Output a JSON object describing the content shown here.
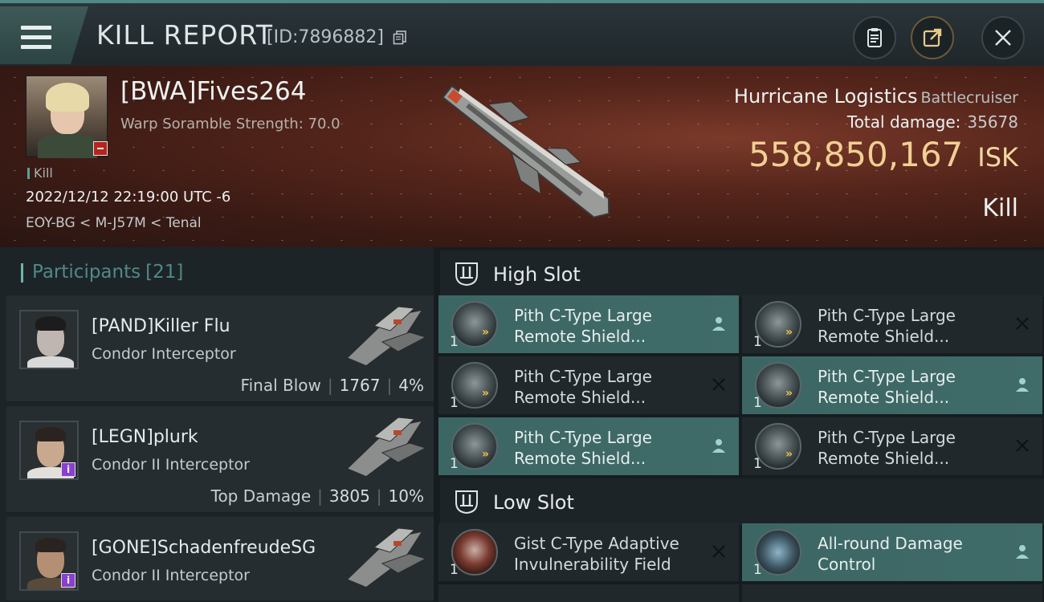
{
  "header": {
    "title": "KILL REPORT",
    "id_label": "[ID:7896882]"
  },
  "victim": {
    "name": "[BWA]Fives264",
    "subtitle": "Warp Soramble Strength: 70.0",
    "tag": "Kill",
    "time": "2022/12/12 22:19:00 UTC -6",
    "location": "EOY-BG < M-J57M < Tenal"
  },
  "ship": {
    "name": "Hurricane Logistics",
    "class": "Battlecruiser",
    "total_damage_label": "Total damage:",
    "total_damage_value": "35678",
    "isk_value": "558,850,167",
    "isk_unit": "ISK",
    "result": "Kill"
  },
  "participants": {
    "label": "Participants",
    "count": "[21]",
    "items": [
      {
        "name": "[PAND]Killer Flu",
        "ship": "Condor Interceptor",
        "stat_label": "Final Blow",
        "damage": "1767",
        "percent": "4%"
      },
      {
        "name": "[LEGN]plurk",
        "ship": "Condor II Interceptor",
        "stat_label": "Top Damage",
        "damage": "3805",
        "percent": "10%"
      },
      {
        "name": "[GONE]SchadenfreudeSG",
        "ship": "Condor II Interceptor",
        "stat_label": "",
        "damage": "",
        "percent": ""
      }
    ]
  },
  "fitting": {
    "high_slot_title": "High Slot",
    "low_slot_title": "Low Slot",
    "high": [
      {
        "name": "Pith C-Type Large Remote Shield...",
        "qty": "1",
        "state": "person",
        "active": true
      },
      {
        "name": "Pith C-Type Large Remote Shield...",
        "qty": "1",
        "state": "x",
        "active": false
      },
      {
        "name": "Pith C-Type Large Remote Shield...",
        "qty": "1",
        "state": "x",
        "active": false
      },
      {
        "name": "Pith C-Type Large Remote Shield...",
        "qty": "1",
        "state": "person",
        "active": true
      },
      {
        "name": "Pith C-Type Large Remote Shield...",
        "qty": "1",
        "state": "person",
        "active": true
      },
      {
        "name": "Pith C-Type Large Remote Shield...",
        "qty": "1",
        "state": "x",
        "active": false
      }
    ],
    "low": [
      {
        "name": "Gist C-Type Adaptive Invulnerability Field",
        "qty": "1",
        "state": "x",
        "active": false
      },
      {
        "name": "All-round Damage Control",
        "qty": "1",
        "state": "person",
        "active": true
      }
    ]
  },
  "colors": {
    "accent": "#4f8a86",
    "isk": "#f2cf92",
    "active_module": "#3f6b69"
  }
}
